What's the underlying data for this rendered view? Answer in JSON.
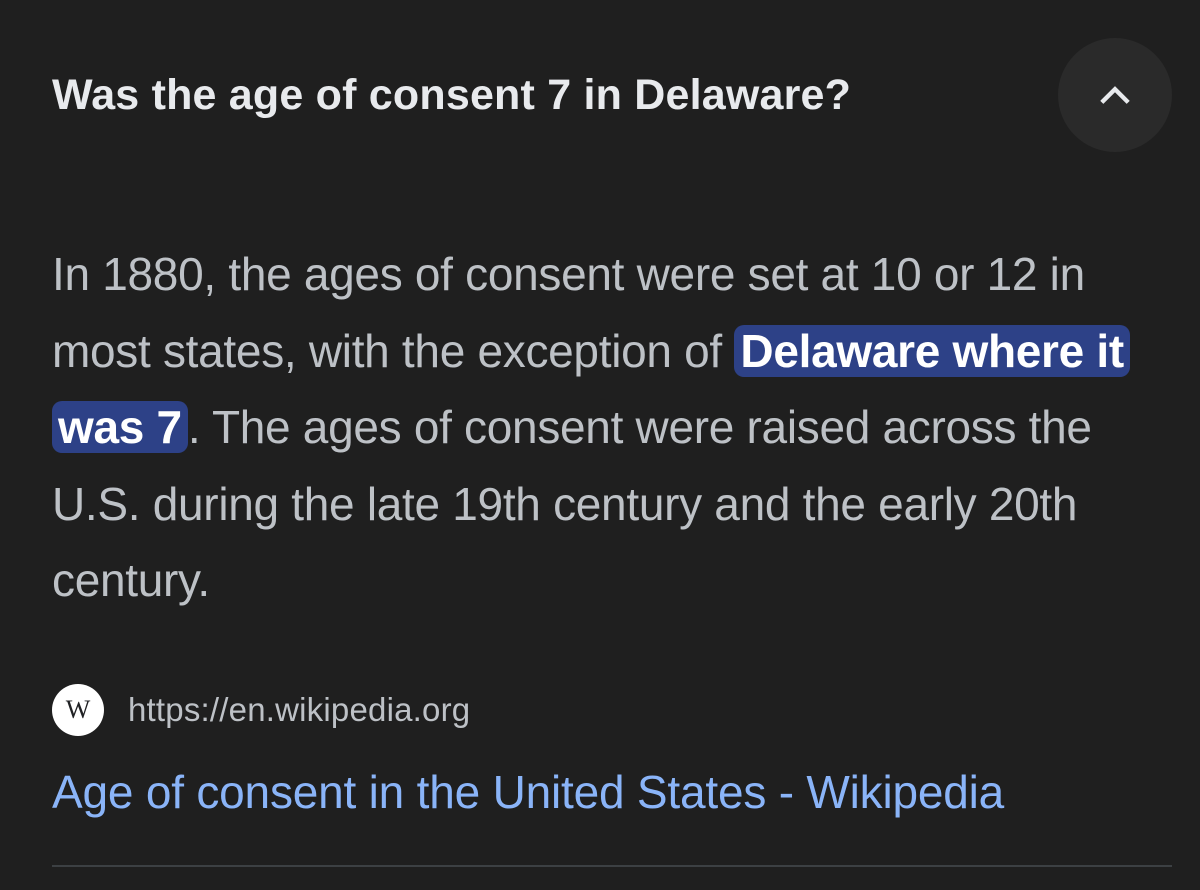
{
  "faq": {
    "question": "Was the age of consent 7 in Delaware?",
    "collapse_icon": "chevron-up-icon",
    "answer": {
      "before": "In 1880, the ages of consent were set at 10 or 12 in most states, with the exception of ",
      "highlight": "Delaware where it was 7",
      "after": ". The ages of consent were raised across the U.S. during the late 19th century and the early 20th century."
    },
    "highlight_color": "#2d4187"
  },
  "source": {
    "favicon_letter": "W",
    "url": "https://en.wikipedia.org",
    "title": "Age of consent in the United States - Wikipedia",
    "link_color": "#8ab4f8"
  }
}
